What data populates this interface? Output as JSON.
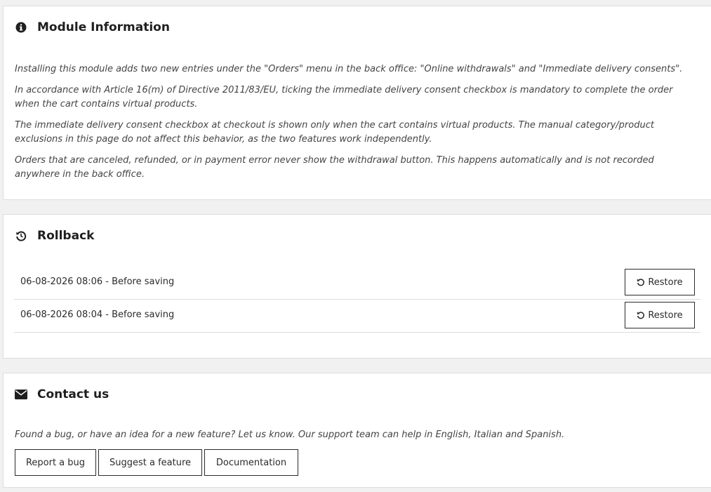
{
  "module_info": {
    "title": "Module Information",
    "icon": "info-circle-icon",
    "paragraphs": [
      "Installing this module adds two new entries under the \"Orders\" menu in the back office: \"Online withdrawals\" and \"Immediate delivery consents\".",
      "In accordance with Article 16(m) of Directive 2011/83/EU, ticking the immediate delivery consent checkbox is mandatory to complete the order when the cart contains virtual products.",
      "The immediate delivery consent checkbox at checkout is shown only when the cart contains virtual products. The manual category/product exclusions in this page do not affect this behavior, as the two features work independently.",
      "Orders that are canceled, refunded, or in payment error never show the withdrawal button. This happens automatically and is not recorded anywhere in the back office."
    ]
  },
  "rollback": {
    "title": "Rollback",
    "icon": "history-icon",
    "entries": [
      {
        "label": "06-08-2026 08:06 - Before saving",
        "button": "Restore"
      },
      {
        "label": "06-08-2026 08:04 - Before saving",
        "button": "Restore"
      }
    ]
  },
  "contact": {
    "title": "Contact us",
    "icon": "envelope-icon",
    "text": "Found a bug, or have an idea for a new feature? Let us know. Our support team can help in English, Italian and Spanish.",
    "buttons": {
      "report_bug": "Report a bug",
      "suggest_feature": "Suggest a feature",
      "documentation": "Documentation"
    }
  }
}
